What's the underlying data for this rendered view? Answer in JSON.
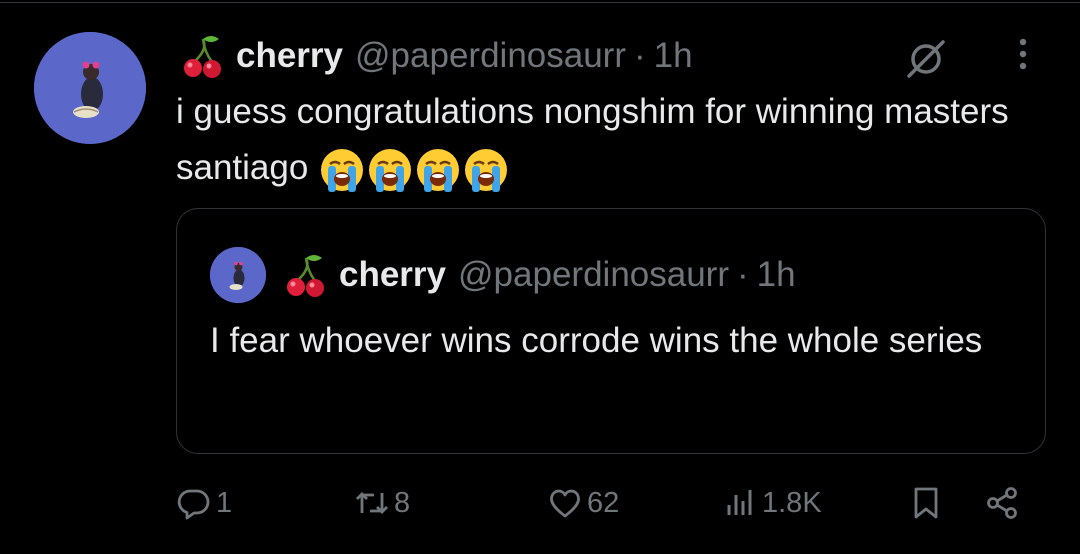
{
  "tweet": {
    "author_name": "cherry",
    "author_handle": "@paperdinosaurr",
    "separator": "·",
    "time": "1h",
    "text": "i guess congratulations nongshim for winning masters santiago",
    "emojis": [
      "loudly-crying-face",
      "loudly-crying-face",
      "loudly-crying-face",
      "loudly-crying-face"
    ],
    "name_emoji": "cherries"
  },
  "quote": {
    "author_name": "cherry",
    "author_handle": "@paperdinosaurr",
    "separator": "·",
    "time": "1h",
    "text": "I fear whoever wins corrode wins the whole series"
  },
  "actions": {
    "replies": "1",
    "retweets": "8",
    "likes": "62",
    "views": "1.8K"
  },
  "colors": {
    "background": "#000000",
    "text": "#e7e9ea",
    "muted": "#71767b",
    "border": "#2f3336",
    "avatar_bg": "#5b67c9"
  }
}
